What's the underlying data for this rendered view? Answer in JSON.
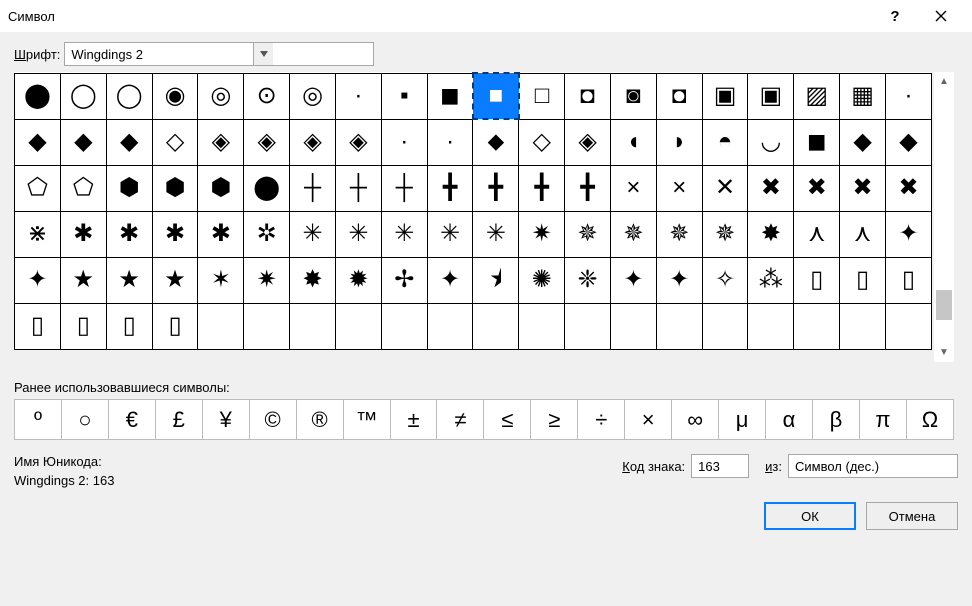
{
  "titlebar": {
    "title": "Символ"
  },
  "font": {
    "label_pre": "Ш",
    "label_post": "рифт:",
    "value": "Wingdings 2"
  },
  "grid": {
    "selected_row": 0,
    "selected_col": 10,
    "rows": [
      [
        "⬤",
        "◯",
        "◯",
        "◉",
        "◎",
        "⊙",
        "◎",
        "·",
        "▪",
        "◼",
        "■",
        "□",
        "◘",
        "◙",
        "◘",
        "▣",
        "▣",
        "▨",
        "▦",
        "·"
      ],
      [
        "◆",
        "◆",
        "◆",
        "◇",
        "◈",
        "◈",
        "◈",
        "◈",
        "·",
        "·",
        "⬥",
        "◇",
        "◈",
        "◖",
        "◗",
        "◓",
        "◡",
        "◼",
        "◆",
        "◆"
      ],
      [
        "⬠",
        "⬠",
        "⬢",
        "⬢",
        "⬢",
        "⬤",
        "┼",
        "┼",
        "┼",
        "╋",
        "╋",
        "╋",
        "╋",
        "×",
        "×",
        "✕",
        "✖",
        "✖",
        "✖",
        "✖"
      ],
      [
        "⋇",
        "✱",
        "✱",
        "✱",
        "✱",
        "✲",
        "✳",
        "✳",
        "✳",
        "✳",
        "✳",
        "✷",
        "✵",
        "✵",
        "✵",
        "✵",
        "✸",
        "⋏",
        "⋏",
        "✦"
      ],
      [
        "✦",
        "★",
        "★",
        "★",
        "✶",
        "✷",
        "✸",
        "✹",
        "✢",
        "✦",
        "⯨",
        "✺",
        "❈",
        "✦",
        "✦",
        "✧",
        "⁂",
        "▯",
        "▯",
        "▯"
      ],
      [
        "▯",
        "▯",
        "▯",
        "▯",
        "",
        "",
        "",
        "",
        "",
        "",
        "",
        "",
        "",
        "",
        "",
        "",
        "",
        "",
        "",
        ""
      ]
    ]
  },
  "recent": {
    "label": "Ранее использовавшиеся символы:",
    "items": [
      "º",
      "○",
      "€",
      "£",
      "¥",
      "©",
      "®",
      "™",
      "±",
      "≠",
      "≤",
      "≥",
      "÷",
      "×",
      "∞",
      "μ",
      "α",
      "β",
      "π",
      "Ω"
    ]
  },
  "unicode": {
    "label": "Имя Юникода:",
    "value": "Wingdings 2: 163"
  },
  "code": {
    "label_pre": "К",
    "label_post": "од знака:",
    "value": "163",
    "from_label_pre": "и",
    "from_label_post": "з:",
    "from_value": "Символ (дес.)"
  },
  "buttons": {
    "ok": "ОК",
    "cancel": "Отмена"
  }
}
